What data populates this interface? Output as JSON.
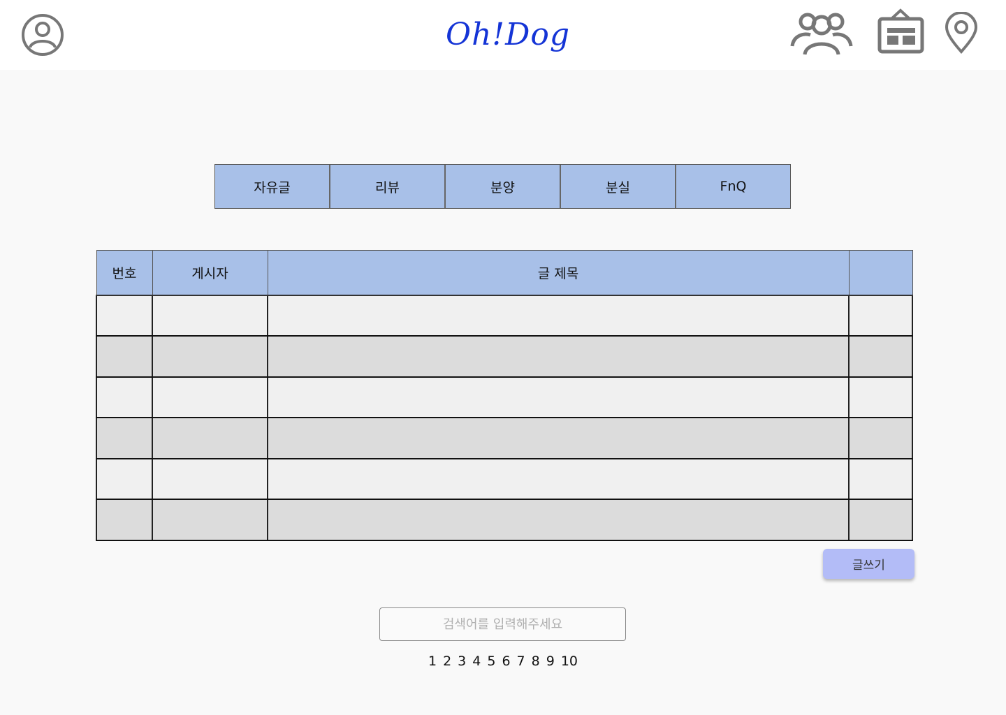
{
  "header": {
    "logo_text": "Oh!Dog",
    "icons": {
      "left": "user-circle-icon",
      "right": [
        "community-icon",
        "store-icon",
        "map-pin-icon"
      ]
    }
  },
  "tabs": [
    {
      "label": "자유글"
    },
    {
      "label": "리뷰"
    },
    {
      "label": "분양"
    },
    {
      "label": "분실"
    },
    {
      "label": "FnQ"
    }
  ],
  "board": {
    "columns": [
      "번호",
      "게시자",
      "글 제목",
      ""
    ],
    "rows": [
      [
        "",
        "",
        "",
        ""
      ],
      [
        "",
        "",
        "",
        ""
      ],
      [
        "",
        "",
        "",
        ""
      ],
      [
        "",
        "",
        "",
        ""
      ],
      [
        "",
        "",
        "",
        ""
      ],
      [
        "",
        "",
        "",
        ""
      ]
    ]
  },
  "write_button": {
    "label": "글쓰기"
  },
  "search": {
    "placeholder": "검색어를 입력해주세요",
    "value": ""
  },
  "pagination": [
    "1",
    "2",
    "3",
    "4",
    "5",
    "6",
    "7",
    "8",
    "9",
    "10"
  ],
  "colors": {
    "accent_header": "#a8c0e8",
    "logo": "#1434d6",
    "write_button": "#b3bcf7",
    "icon_gray": "#777777"
  }
}
